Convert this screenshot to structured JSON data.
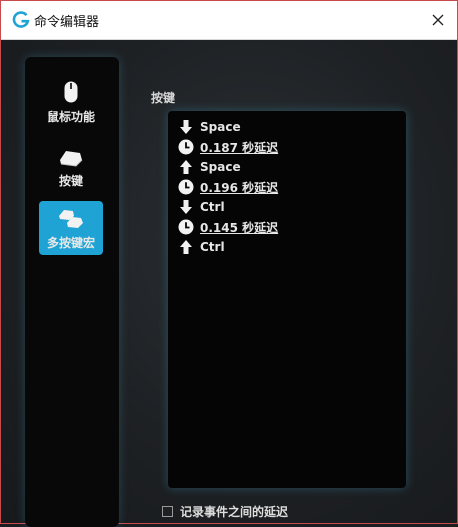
{
  "window": {
    "title": "命令编辑器"
  },
  "sidebar": {
    "items": [
      {
        "label": "鼠标功能",
        "icon": "mouse-icon"
      },
      {
        "label": "按键",
        "icon": "key-icon"
      },
      {
        "label": "多按键宏",
        "icon": "multi-key-icon",
        "active": true
      }
    ]
  },
  "main": {
    "section_label": "按键",
    "entries": [
      {
        "icon": "arrow-down-icon",
        "text": "Space",
        "kind": "key-down"
      },
      {
        "icon": "clock-icon",
        "text": "0.187 秒延迟",
        "kind": "delay"
      },
      {
        "icon": "arrow-up-icon",
        "text": "Space",
        "kind": "key-up"
      },
      {
        "icon": "clock-icon",
        "text": "0.196 秒延迟",
        "kind": "delay"
      },
      {
        "icon": "arrow-down-icon",
        "text": "Ctrl",
        "kind": "key-down"
      },
      {
        "icon": "clock-icon",
        "text": "0.145 秒延迟",
        "kind": "delay"
      },
      {
        "icon": "arrow-up-icon",
        "text": "Ctrl",
        "kind": "key-up"
      }
    ]
  },
  "footer": {
    "record_delay_label": "记录事件之间的延迟",
    "record_delay_checked": false
  },
  "colors": {
    "accent": "#1fa3d4",
    "glow": "#46bee6",
    "panel": "#050505",
    "frame": "#c94a4a"
  }
}
